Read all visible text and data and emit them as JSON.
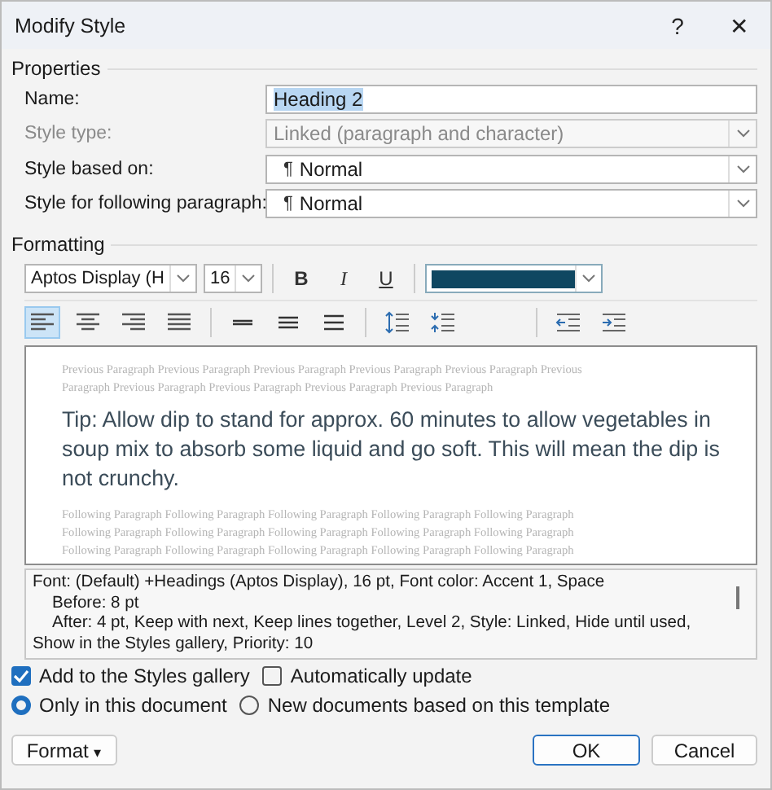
{
  "window": {
    "title": "Modify Style",
    "help": "?",
    "close": "✕"
  },
  "properties": {
    "title": "Properties",
    "fields": [
      {
        "label": "Name:",
        "kind": "text",
        "value": "Heading 2",
        "text_selected": true,
        "disabled": false
      },
      {
        "label": "Style type:",
        "kind": "dropdown",
        "value": "Linked (paragraph and character)",
        "disabled": true
      },
      {
        "label": "Style based on:",
        "kind": "dropdown",
        "pilcrow": "¶",
        "value": "Normal",
        "disabled": false
      },
      {
        "label": "Style for following paragraph:",
        "kind": "dropdown",
        "pilcrow": "¶",
        "value": "Normal",
        "disabled": false
      }
    ]
  },
  "formatting": {
    "title": "Formatting",
    "font": "Aptos Display (H",
    "size": "16",
    "styles": [
      {
        "label": "B",
        "kind": "bold",
        "selected": false
      },
      {
        "label": "I",
        "kind": "italic",
        "selected": false
      },
      {
        "label": "U",
        "kind": "underline",
        "selected": false
      }
    ],
    "color": "#0f4761",
    "paragraph_groups": [
      [
        {
          "kind": "align-left",
          "selected": true
        },
        {
          "kind": "align-center",
          "selected": false
        },
        {
          "kind": "align-right",
          "selected": false
        },
        {
          "kind": "justify",
          "selected": false
        }
      ],
      [
        {
          "kind": "single-spacing",
          "selected": false
        },
        {
          "kind": "one-half-spacing",
          "selected": false
        },
        {
          "kind": "double-spacing",
          "selected": false
        }
      ],
      [
        {
          "kind": "space-increase",
          "selected": false
        },
        {
          "kind": "space-decrease",
          "selected": false
        }
      ],
      [
        {
          "kind": "indent-decrease",
          "selected": false
        },
        {
          "kind": "indent-increase",
          "selected": false
        }
      ]
    ]
  },
  "preview": {
    "previous": [
      "Previous Paragraph Previous Paragraph Previous Paragraph Previous Paragraph Previous Paragraph Previous",
      "Paragraph Previous Paragraph Previous Paragraph Previous Paragraph Previous Paragraph"
    ],
    "sample": "Tip: Allow dip to stand for approx. 60 minutes to allow vegetables in soup mix to absorb some liquid and go soft. This will mean the dip is not crunchy.",
    "following": [
      "Following Paragraph Following Paragraph Following Paragraph Following Paragraph Following Paragraph",
      "Following Paragraph Following Paragraph Following Paragraph Following Paragraph Following Paragraph",
      "Following Paragraph Following Paragraph Following Paragraph Following Paragraph Following Paragraph"
    ]
  },
  "description": [
    "Font: (Default) +Headings (Aptos Display), 16 pt, Font color: Accent 1, Space",
    "Before:  8 pt",
    "After:  4 pt, Keep with next, Keep lines together, Level 2, Style: Linked, Hide until used,",
    "Show in the Styles gallery, Priority: 10"
  ],
  "checkboxes": [
    {
      "label": "Add to the Styles gallery",
      "checked": true
    },
    {
      "label": "Automatically update",
      "checked": false
    }
  ],
  "radios": [
    {
      "label": "Only in this document",
      "selected": true
    },
    {
      "label": "New documents based on this template",
      "selected": false
    }
  ],
  "format_button": {
    "label": "Format",
    "caret": "▾"
  },
  "buttons": [
    {
      "label": "OK",
      "kind": "default"
    },
    {
      "label": "Cancel",
      "kind": "normal"
    }
  ]
}
